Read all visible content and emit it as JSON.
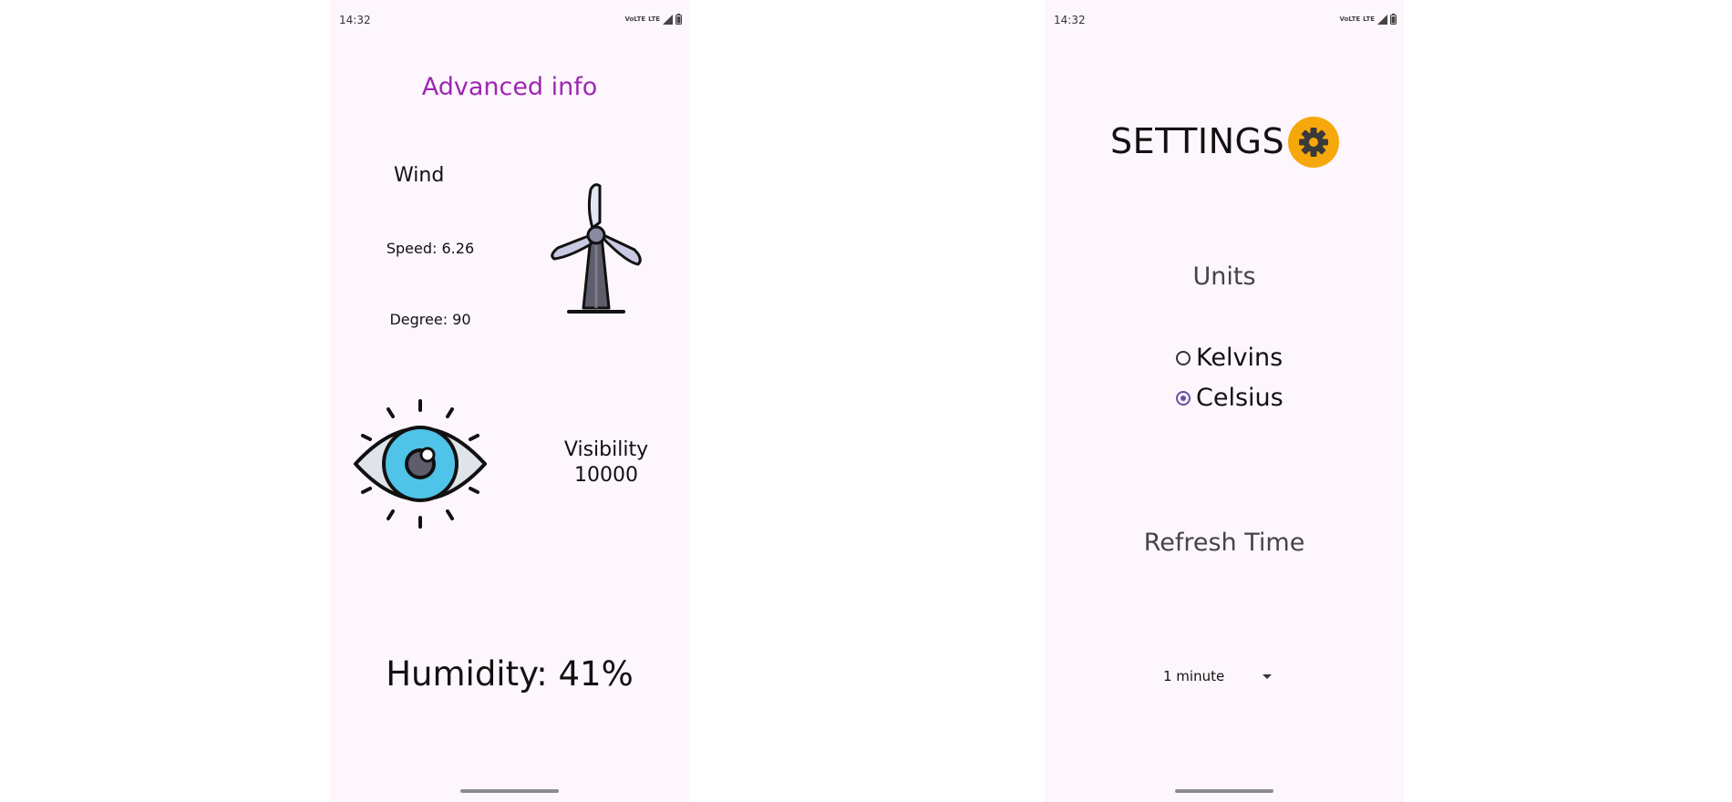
{
  "status_bar": {
    "time": "14:32",
    "volte": "VoLTE",
    "lte": "LTE"
  },
  "advanced": {
    "title": "Advanced info",
    "wind_label": "Wind",
    "speed": "Speed: 6.26",
    "degree": "Degree: 90",
    "visibility_label": "Visibility",
    "visibility_value": "10000",
    "humidity": "Humidity: 41%"
  },
  "settings": {
    "title": "SETTINGS",
    "units_title": "Units",
    "units_options": [
      "Kelvins",
      "Celsius"
    ],
    "units_selected": "Celsius",
    "refresh_title": "Refresh Time",
    "refresh_value": "1 minute"
  },
  "colors": {
    "accent": "#9c27b0",
    "radio_accent": "#6750a4",
    "gear_badge": "#f6a80b",
    "background": "#fdf6fd"
  },
  "icons": [
    "wind-turbine-icon",
    "eye-icon",
    "gear-icon",
    "signal-icon",
    "battery-icon",
    "chevron-down-icon"
  ]
}
